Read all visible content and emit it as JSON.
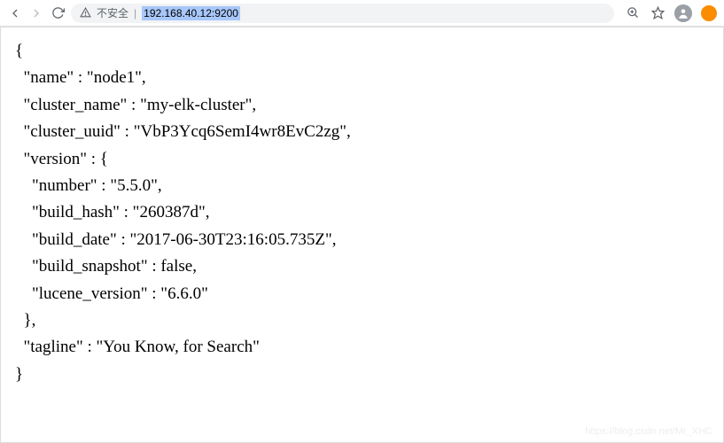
{
  "browser": {
    "not_secure_label": "不安全",
    "url": "192.168.40.12:9200"
  },
  "json_response": {
    "name": "node1",
    "cluster_name": "my-elk-cluster",
    "cluster_uuid": "VbP3Ycq6SemI4wr8EvC2zg",
    "version": {
      "number": "5.5.0",
      "build_hash": "260387d",
      "build_date": "2017-06-30T23:16:05.735Z",
      "build_snapshot": false,
      "lucene_version": "6.6.0"
    },
    "tagline": "You Know, for Search"
  },
  "watermark": "https://blog.csdn.net/Mr_XHC"
}
